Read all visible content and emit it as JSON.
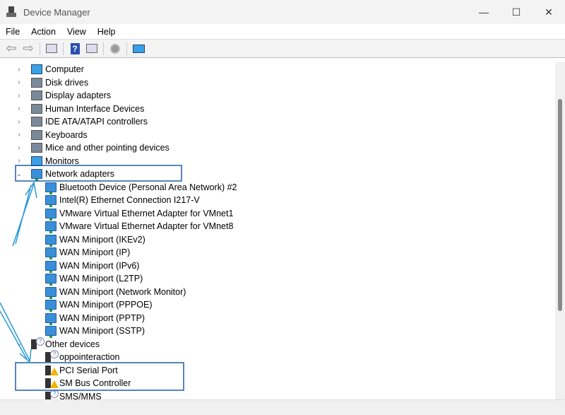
{
  "window": {
    "title": "Device Manager",
    "minimize": "—",
    "maximize": "☐",
    "close": "✕"
  },
  "menu": [
    "File",
    "Action",
    "View",
    "Help"
  ],
  "toolbar": {
    "back": "⇦",
    "forward": "⇨",
    "help": "?"
  },
  "tree": {
    "categories": [
      {
        "label": "Computer",
        "icon": "computer-icon",
        "type": "mon"
      },
      {
        "label": "Disk drives",
        "icon": "disk-icon",
        "type": "gen"
      },
      {
        "label": "Display adapters",
        "icon": "display-icon",
        "type": "gen"
      },
      {
        "label": "Human Interface Devices",
        "icon": "hid-icon",
        "type": "gen"
      },
      {
        "label": "IDE ATA/ATAPI controllers",
        "icon": "ide-icon",
        "type": "gen"
      },
      {
        "label": "Keyboards",
        "icon": "keyboard-icon",
        "type": "gen"
      },
      {
        "label": "Mice and other pointing devices",
        "icon": "mouse-icon",
        "type": "gen"
      },
      {
        "label": "Monitors",
        "icon": "monitor-icon",
        "type": "mon"
      }
    ],
    "network": {
      "label": "Network adapters",
      "children": [
        "Bluetooth Device (Personal Area Network) #2",
        "Intel(R) Ethernet Connection I217-V",
        "VMware Virtual Ethernet Adapter for VMnet1",
        "VMware Virtual Ethernet Adapter for VMnet8",
        "WAN Miniport (IKEv2)",
        "WAN Miniport (IP)",
        "WAN Miniport (IPv6)",
        "WAN Miniport (L2TP)",
        "WAN Miniport (Network Monitor)",
        "WAN Miniport (PPPOE)",
        "WAN Miniport (PPTP)",
        "WAN Miniport (SSTP)"
      ]
    },
    "other": {
      "label": "Other devices",
      "children": [
        {
          "label": "oppointeraction",
          "status": "unknown"
        },
        {
          "label": "PCI Serial Port",
          "status": "warning"
        },
        {
          "label": "SM Bus Controller",
          "status": "warning"
        },
        {
          "label": "SMS/MMS",
          "status": "unknown"
        }
      ]
    }
  },
  "colors": {
    "annotation": "#1f5fa8",
    "arrow": "#2a9ad8"
  }
}
